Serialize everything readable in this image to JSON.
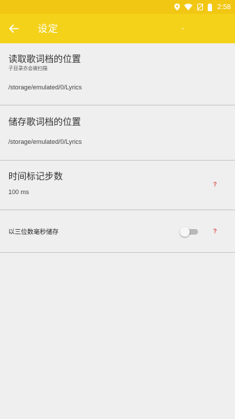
{
  "status_bar": {
    "time": "2:58",
    "icons": [
      "location-icon",
      "wifi-icon",
      "no-sim-icon",
      "battery-icon"
    ]
  },
  "toolbar": {
    "title": "设定",
    "back_icon": "arrow-left-icon"
  },
  "settings": {
    "items": [
      {
        "title": "读取歌词档的位置",
        "subtitle": "子目录亦会被扫描",
        "value": "/storage/emulated/0/Lyrics"
      },
      {
        "title": "储存歌词档的位置",
        "value": "/storage/emulated/0/Lyrics"
      },
      {
        "title": "时间标记步数",
        "value": "100 ms",
        "help": "?"
      },
      {
        "title": "以三位数毫秒储存",
        "toggle_on": false,
        "help": "?"
      }
    ]
  },
  "colors": {
    "status_bar": "#f2c713",
    "toolbar": "#f4d21a",
    "background": "#efefef",
    "divider": "#c6c6c6",
    "help": "#d9534f"
  }
}
